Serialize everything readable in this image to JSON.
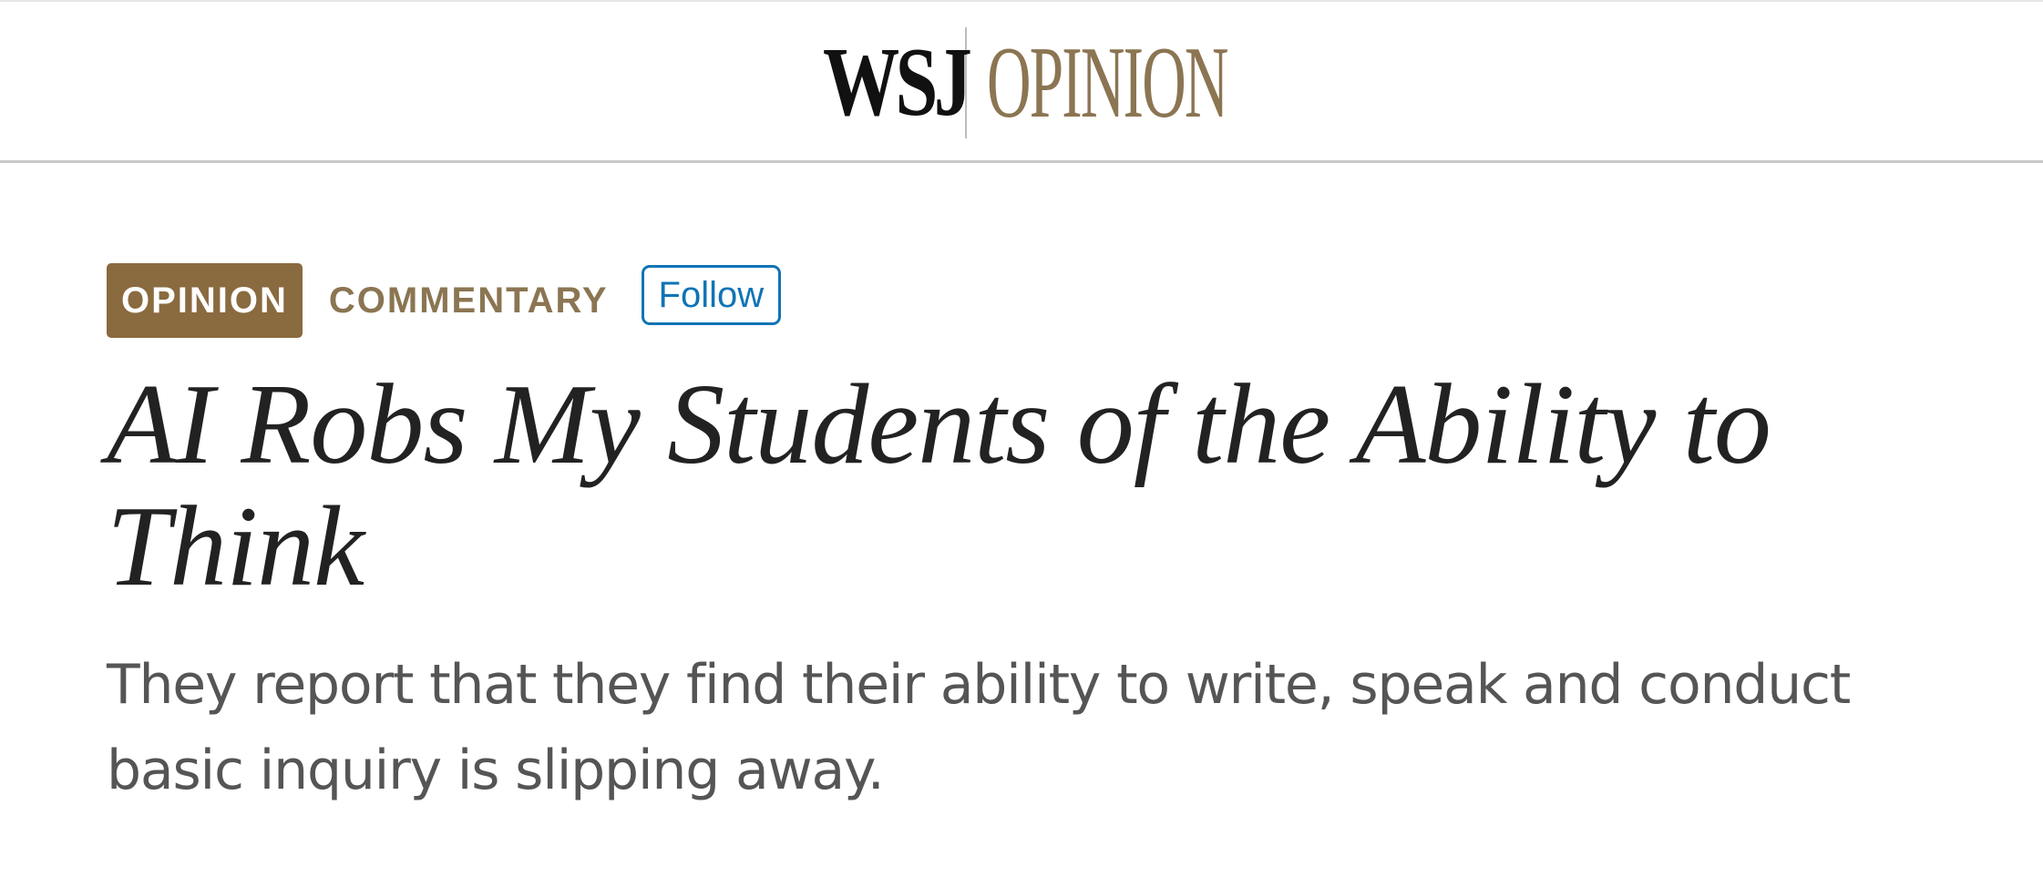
{
  "masthead": {
    "brand": "WSJ",
    "section": "OPINION"
  },
  "kicker": {
    "badge": "OPINION",
    "category": "COMMENTARY",
    "follow_label": "Follow"
  },
  "article": {
    "headline": "AI Robs My Students of the Ability to Think",
    "dek": "They report that they find their ability to write, speak and conduct basic inquiry is slipping away."
  },
  "colors": {
    "opinion_brown": "#8a6a3f",
    "opinion_gold_text": "#8b7552",
    "follow_blue": "#0f74b5",
    "headline_text": "#222222",
    "dek_text": "#555555"
  }
}
